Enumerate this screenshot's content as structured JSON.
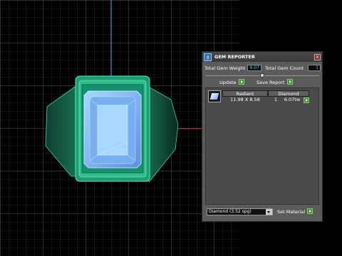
{
  "panel": {
    "title": "GEM REPORTER",
    "logo_glyph": "g",
    "close_glyph": "x",
    "total_weight_label": "Total Gem Weight",
    "total_weight_value": "6.07",
    "total_count_label": "Total Gem Count",
    "total_count_value": "1",
    "update_label": "Update",
    "save_report_label": "Save Report",
    "gem": {
      "cut": "Radiant",
      "material": "Diamond",
      "dimensions": "11.98 X 8.58",
      "count": "1",
      "weight": "6.07tw"
    },
    "material_select": "Diamond    (3.52 spg)",
    "set_material_label": "Set Material"
  },
  "colors": {
    "accent_value": "#46e0ff",
    "play_green": "#3c9a2c",
    "ring_green": "#1f9a72",
    "gem_blue": "#8ec8ff"
  },
  "icons": {
    "logo": "gem-reporter-logo-icon",
    "close": "close-icon",
    "play": "play-arrow-icon",
    "dropdown": "chevron-down-icon"
  }
}
